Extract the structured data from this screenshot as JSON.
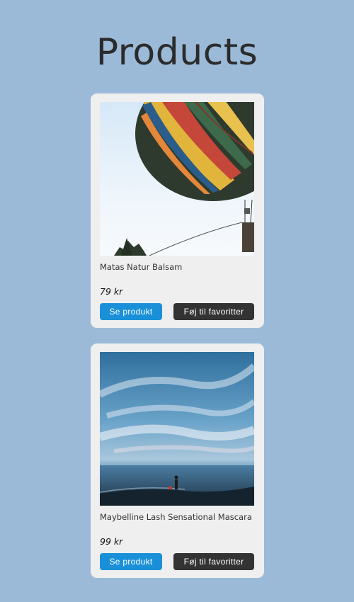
{
  "page": {
    "title": "Products"
  },
  "products": [
    {
      "name": "Matas Natur Balsam",
      "price": "79 kr",
      "view_label": "Se produkt",
      "favorite_label": "Føj til favoritter"
    },
    {
      "name": "Maybelline Lash Sensational Mascara",
      "price": "99 kr",
      "view_label": "Se produkt",
      "favorite_label": "Føj til favoritter"
    }
  ],
  "colors": {
    "background": "#9bbad8",
    "card": "#efefef",
    "primary_button": "#1a90d9",
    "secondary_button": "#333333",
    "title_text": "#2b2b2b"
  }
}
